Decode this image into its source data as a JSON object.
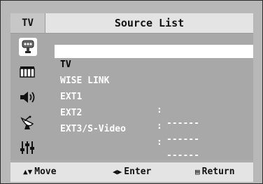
{
  "header": {
    "tv_tag": "TV",
    "title": "Source List"
  },
  "sidebar": {
    "icons": [
      {
        "name": "input-icon",
        "active": true
      },
      {
        "name": "picture-icon",
        "active": false
      },
      {
        "name": "sound-icon",
        "active": false
      },
      {
        "name": "channel-icon",
        "active": false
      },
      {
        "name": "setup-icon",
        "active": false
      }
    ]
  },
  "sources": [
    {
      "label": "TV",
      "separator": "",
      "value": "",
      "selected": true
    },
    {
      "label": "WISE LINK",
      "separator": "",
      "value": "",
      "selected": false
    },
    {
      "label": "EXT1",
      "separator": ":",
      "value": "------",
      "selected": false
    },
    {
      "label": "EXT2",
      "separator": ":",
      "value": "------",
      "selected": false
    },
    {
      "label": "EXT3/S-Video",
      "separator": ":",
      "value": "------",
      "selected": false
    }
  ],
  "footer": {
    "move": {
      "glyph": "▲▼",
      "label": "Move"
    },
    "enter": {
      "glyph": "◀▶",
      "label": "Enter"
    },
    "return": {
      "glyph": "▤",
      "label": "Return"
    }
  }
}
